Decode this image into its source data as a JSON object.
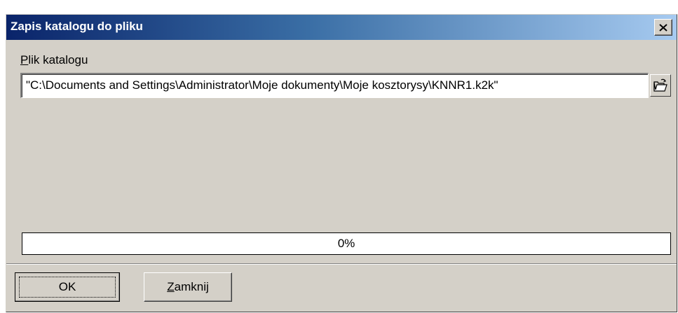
{
  "window": {
    "title": "Zapis katalogu do pliku",
    "close_glyph": "✕"
  },
  "field": {
    "label_first": "P",
    "label_rest": "lik katalogu",
    "value": "\"C:\\Documents and Settings\\Administrator\\Moje dokumenty\\Moje kosztorysy\\KNNR1.k2k\"",
    "browse_icon": "open-folder-icon"
  },
  "progress": {
    "value": 0,
    "text": "0%"
  },
  "buttons": {
    "ok_label": "OK",
    "close_first": "Z",
    "close_rest": "amknij"
  },
  "colors": {
    "title_start": "#0a246a",
    "title_end": "#a6caf0",
    "dialog_bg": "#d4d0c8",
    "progress_fill": "#0a246a"
  }
}
